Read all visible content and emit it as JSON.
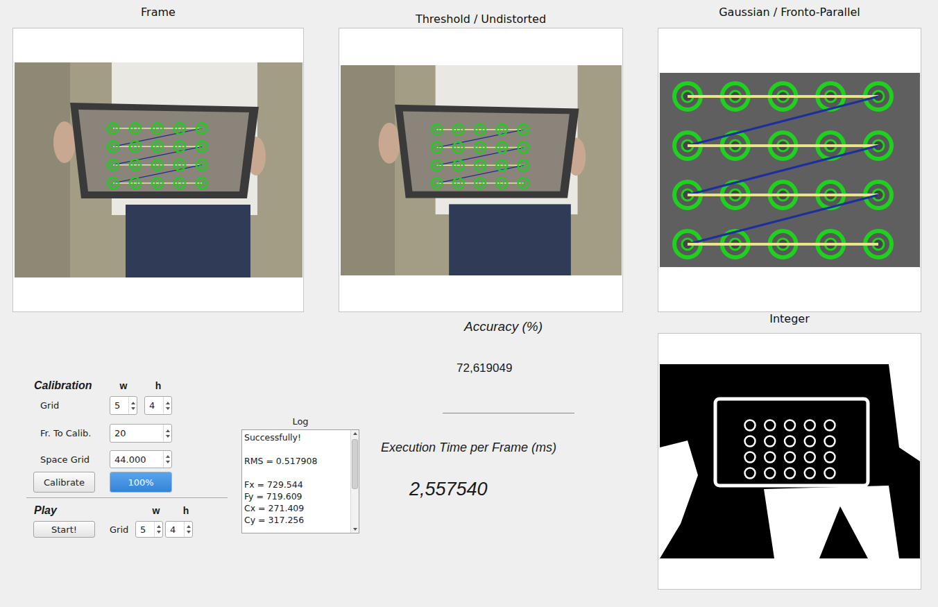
{
  "panels": {
    "frame": {
      "title": "Frame"
    },
    "threshold": {
      "title": "Threshold / Undistorted"
    },
    "gaussian": {
      "title": "Gaussian / Fronto-Parallel"
    },
    "integer": {
      "title": "Integer"
    }
  },
  "calibration": {
    "title": "Calibration",
    "w_label": "w",
    "h_label": "h",
    "grid_label": "Grid",
    "grid_w": "5",
    "grid_h": "4",
    "frames_label": "Fr. To Calib.",
    "frames": "20",
    "space_label": "Space Grid",
    "space": "44.000",
    "calibrate_button": "Calibrate",
    "progress": {
      "level": 1,
      "text": "100%"
    }
  },
  "play": {
    "title": "Play",
    "w_label": "w",
    "h_label": "h",
    "start_button": "Start!",
    "grid_label": "Grid",
    "grid_w": "5",
    "grid_h": "4"
  },
  "log": {
    "title": "Log",
    "lines": [
      "Successfully!",
      "",
      "RMS = 0.517908",
      "",
      "Fx = 729.544",
      "Fy = 719.609",
      "Cx = 271.409",
      "Cy = 317.256"
    ]
  },
  "accuracy": {
    "title": "Accuracy (%)",
    "value": "72,619049"
  },
  "execution": {
    "title": "Execution Time per Frame (ms)",
    "value": "2,557540"
  }
}
